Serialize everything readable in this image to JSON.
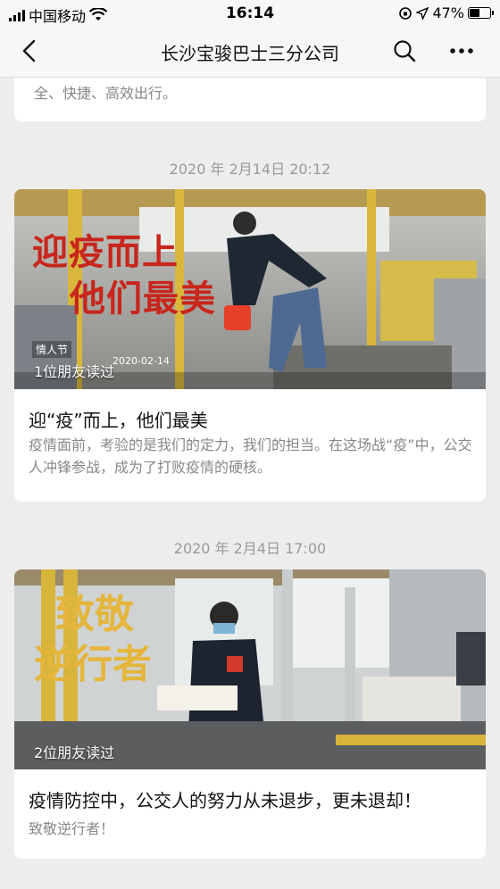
{
  "status_bar": {
    "carrier": "中国移动",
    "time": "16:14",
    "battery": "47%",
    "battery_level": 0.47
  },
  "nav": {
    "title": "长沙宝骏巴士三分公司",
    "back_icon": "back-chevron-icon",
    "search_icon": "search-icon",
    "more_icon": "more-dots-icon"
  },
  "top_card": {
    "text": "全、快捷、高效出行。"
  },
  "articles": [
    {
      "date": "2020 年 2月14日 20:12",
      "cover_headline_1": "迎疫而上",
      "cover_headline_2": "他们最美",
      "readers": "1位朋友读过",
      "cover_badge": "情人节",
      "cover_stamp": "2020-02-14",
      "title": "迎“疫”而上，他们最美",
      "desc": "疫情面前，考验的是我们的定力，我们的担当。在这场战“疫”中，公交人冲锋参战，成为了打败疫情的硬核。"
    },
    {
      "date": "2020 年 2月4日 17:00",
      "cover_headline_1": "致敬",
      "cover_headline_2": "逆行者",
      "readers": "2位朋友读过",
      "title": "疫情防控中，公交人的努力从未退步，更未退却！",
      "desc": "致敬逆行者！"
    }
  ]
}
